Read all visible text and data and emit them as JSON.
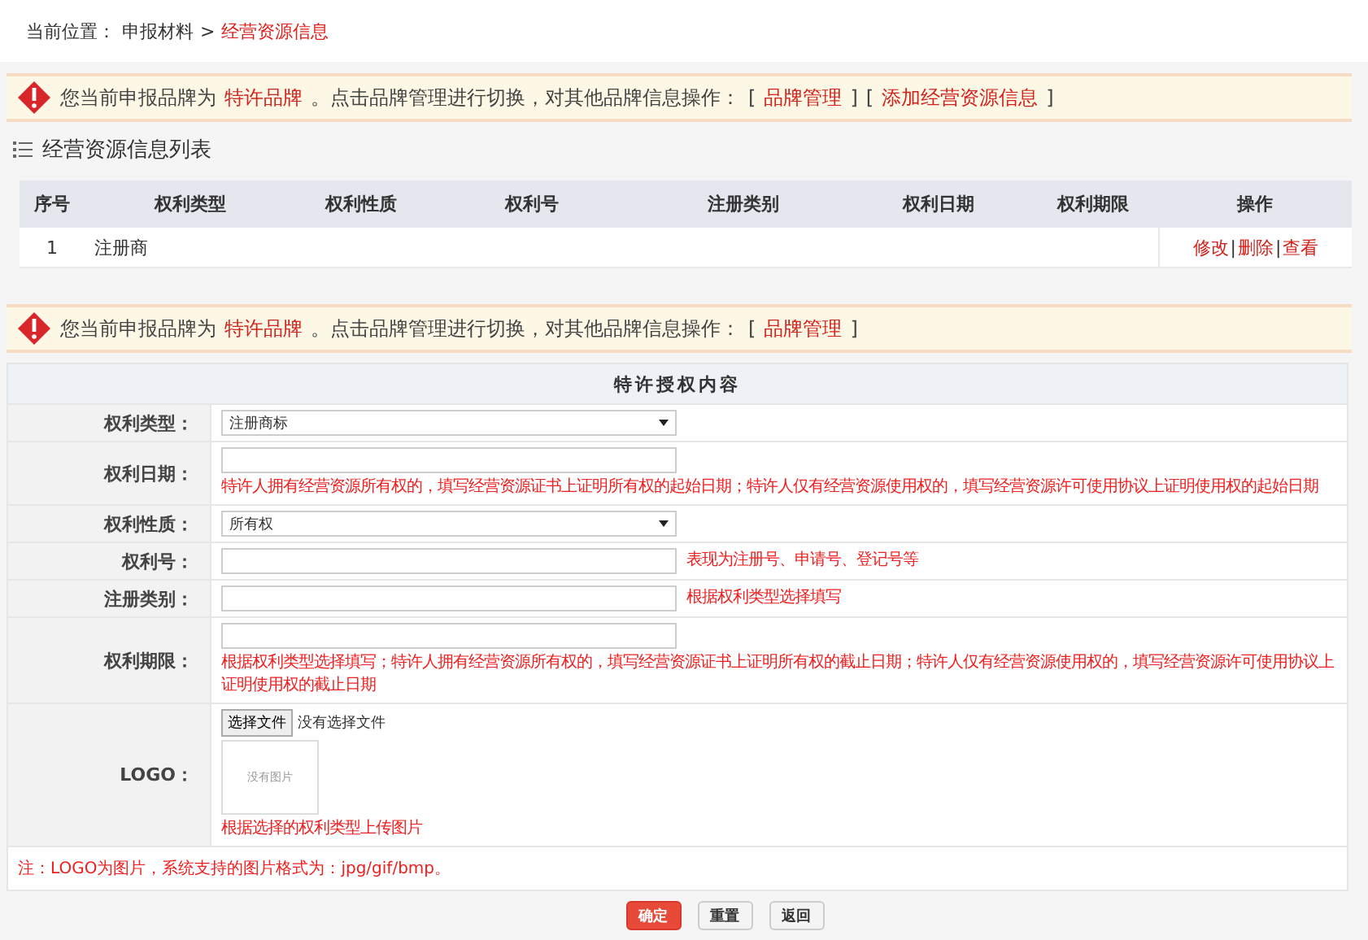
{
  "breadcrumb": {
    "prefix": "当前位置：",
    "separator": ">",
    "path": [
      {
        "text": "申报材料",
        "selected": false
      },
      {
        "text": "经营资源信息",
        "selected": true
      }
    ]
  },
  "notice_top": {
    "before": "您当前申报品牌为",
    "brand": "特许品牌",
    "after": "。点击品牌管理进行切换，对其他品牌信息操作：",
    "links": [
      {
        "open": "[",
        "label": "品牌管理",
        "close": "]"
      },
      {
        "open": "[",
        "label": "添加经营资源信息",
        "close": "]"
      }
    ]
  },
  "list": {
    "title": "经营资源信息列表",
    "columns": [
      "序号",
      "权利类型",
      "权利性质",
      "权利号",
      "注册类别",
      "权利日期",
      "权利期限",
      "操作"
    ],
    "action_separator": "|",
    "rows": [
      {
        "cells": [
          "1",
          "注册商"
        ],
        "actions": [
          "修改",
          "删除",
          "查看"
        ]
      }
    ]
  },
  "notice_form": {
    "before": "您当前申报品牌为",
    "brand": "特许品牌",
    "after": "。点击品牌管理进行切换，对其他品牌信息操作：",
    "links": [
      {
        "open": "[",
        "label": "品牌管理",
        "close": "]"
      }
    ]
  },
  "form": {
    "title": "特许授权内容",
    "fields": [
      {
        "kind": "select",
        "label": "权利类型：",
        "value": "注册商标"
      },
      {
        "kind": "input",
        "label": "权利日期：",
        "hint": "特许人拥有经营资源所有权的，填写经营资源证书上证明所有权的起始日期；特许人仅有经营资源使用权的，填写经营资源许可使用协议上证明使用权的起始日期"
      },
      {
        "kind": "select",
        "label": "权利性质：",
        "value": "所有权"
      },
      {
        "kind": "inline",
        "label": "权利号：",
        "hint": "表现为注册号、申请号、登记号等"
      },
      {
        "kind": "inline",
        "label": "注册类别：",
        "hint": "根据权利类型选择填写"
      },
      {
        "kind": "input",
        "label": "权利期限：",
        "hint": "根据权利类型选择填写；特许人拥有经营资源所有权的，填写经营资源证书上证明所有权的截止日期；特许人仅有经营资源使用权的，填写经营资源许可使用协议上证明使用权的截止日期"
      },
      {
        "kind": "file",
        "label": "LOGO：",
        "button": "选择文件",
        "status": "没有选择文件",
        "preview": "没有图片",
        "hint": "根据选择的权利类型上传图片"
      }
    ],
    "note": "注：LOGO为图片，系统支持的图片格式为：jpg/gif/bmp。"
  },
  "buttons": [
    {
      "label": "确定",
      "kind": "primary"
    },
    {
      "label": "重置",
      "kind": "default"
    },
    {
      "label": "返回",
      "kind": "default"
    }
  ]
}
